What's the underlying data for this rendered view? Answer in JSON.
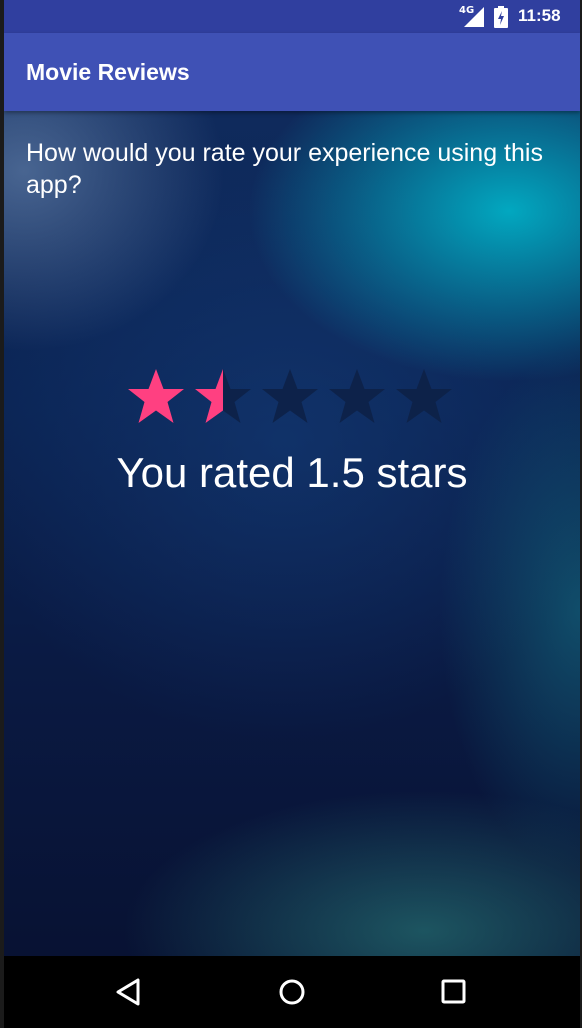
{
  "status_bar": {
    "network": "4G",
    "time": "11:58"
  },
  "app_bar": {
    "title": "Movie Reviews"
  },
  "main": {
    "question": "How would you rate your experience using this app?",
    "rating": {
      "value": 1.5,
      "max": 5,
      "filled_color": "#ff4081",
      "empty_color": "#0d2147"
    },
    "rated_text": "You rated 1.5 stars"
  },
  "nav_bar": {
    "buttons": [
      "back-icon",
      "home-icon",
      "recents-icon"
    ]
  },
  "colors": {
    "primary": "#3f51b5",
    "primary_dark": "#303f9f",
    "accent": "#ff4081"
  }
}
